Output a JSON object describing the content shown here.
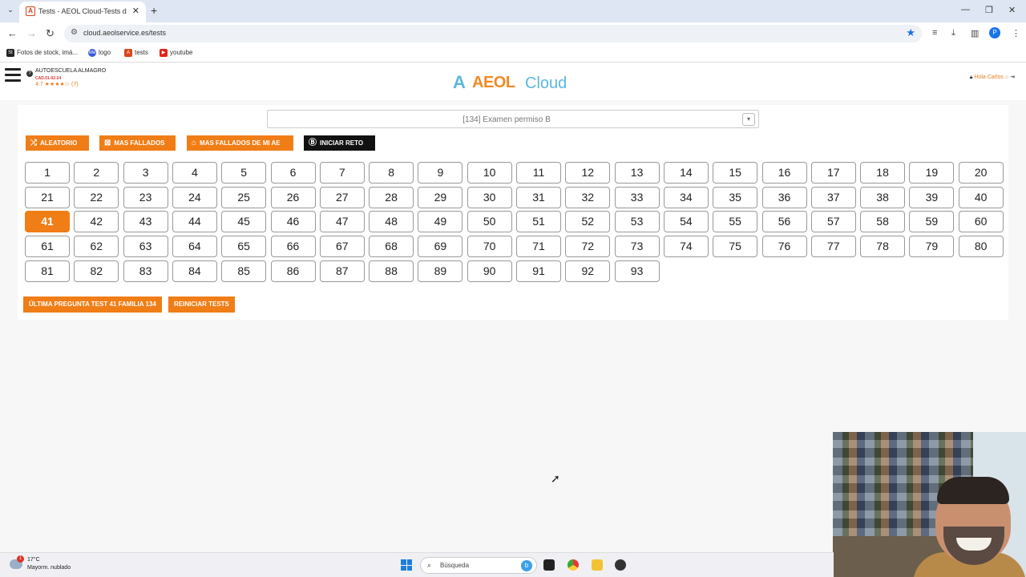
{
  "browser": {
    "tab_title": "Tests - AEOL Cloud-Tests de Au",
    "url": "cloud.aeolservice.es/tests",
    "profile_initial": "P",
    "bookmarks": [
      {
        "label": "Fotos de stock, imá...",
        "icon": "St"
      },
      {
        "label": "logo",
        "icon": "Me"
      },
      {
        "label": "tests",
        "icon": "A"
      },
      {
        "label": "youtube",
        "icon": "▶"
      }
    ]
  },
  "header": {
    "school_name": "AUTOESCUELA ALMAGRO",
    "school_code": "CAD.01-02-24",
    "rating": "4.7 ★★★★☆ (7)",
    "logo_a": "AEOL",
    "logo_b": "Cloud",
    "greeting": "Hola Carlos"
  },
  "selector": {
    "value": "[134] Examen permiso B"
  },
  "actions": {
    "random": "ALEATORIO",
    "most_failed": "MAS FALLADOS",
    "most_failed_ae": "MAS FALLADOS DE MI AE",
    "challenge": "INICIAR RETO"
  },
  "tests": {
    "numbers": [
      "1",
      "2",
      "3",
      "4",
      "5",
      "6",
      "7",
      "8",
      "9",
      "10",
      "11",
      "12",
      "13",
      "14",
      "15",
      "16",
      "17",
      "18",
      "19",
      "20",
      "21",
      "22",
      "23",
      "24",
      "25",
      "26",
      "27",
      "28",
      "29",
      "30",
      "31",
      "32",
      "33",
      "34",
      "35",
      "36",
      "37",
      "38",
      "39",
      "40",
      "41",
      "42",
      "43",
      "44",
      "45",
      "46",
      "47",
      "48",
      "49",
      "50",
      "51",
      "52",
      "53",
      "54",
      "55",
      "56",
      "57",
      "58",
      "59",
      "60",
      "61",
      "62",
      "63",
      "64",
      "65",
      "66",
      "67",
      "68",
      "69",
      "70",
      "71",
      "72",
      "73",
      "74",
      "75",
      "76",
      "77",
      "78",
      "79",
      "80",
      "81",
      "82",
      "83",
      "84",
      "85",
      "86",
      "87",
      "88",
      "89",
      "90",
      "91",
      "92",
      "93"
    ],
    "active": "41"
  },
  "footer_actions": {
    "last_question": "ÚLTIMA PREGUNTA TEST 41 FAMILIA 134",
    "reset": "REINICIAR TESTS"
  },
  "taskbar": {
    "temperature": "17°C",
    "weather": "Mayorm. nublado",
    "weather_badge": "1",
    "search_placeholder": "Búsqueda"
  },
  "colors": {
    "accent": "#f07d16",
    "brand_blue": "#5bb7dd"
  }
}
